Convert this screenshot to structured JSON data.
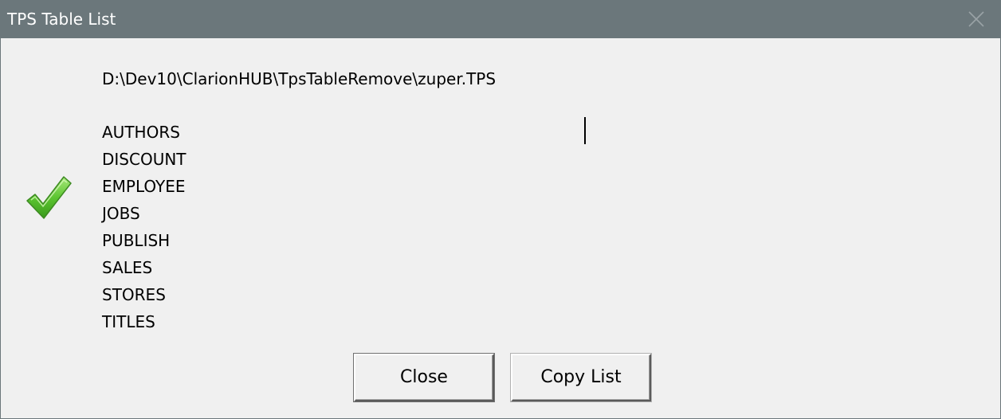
{
  "window": {
    "title": "TPS Table List"
  },
  "file_path": "D:\\Dev10\\ClarionHUB\\TpsTableRemove\\zuper.TPS",
  "tables": [
    "AUTHORS",
    "DISCOUNT",
    "EMPLOYEE",
    "JOBS",
    "PUBLISH",
    "SALES",
    "STORES",
    "TITLES"
  ],
  "icons": {
    "status": "checkmark-icon",
    "close": "close-icon"
  },
  "colors": {
    "titlebar": "#6b777b",
    "check_green": "#5cc531",
    "background": "#f0f0f0"
  },
  "buttons": {
    "close_label": "Close",
    "copy_label": "Copy List"
  }
}
